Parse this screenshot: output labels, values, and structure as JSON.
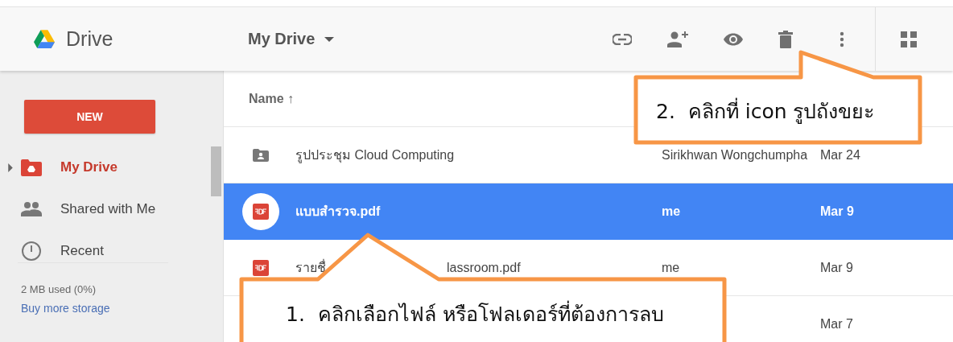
{
  "app": {
    "name": "Drive"
  },
  "location": {
    "title": "My Drive"
  },
  "new_button": "NEW",
  "sidebar": {
    "items": [
      {
        "kind": "drive",
        "label": "My Drive",
        "selected": true
      },
      {
        "kind": "shared",
        "label": "Shared with Me",
        "selected": false
      },
      {
        "kind": "recent",
        "label": "Recent",
        "selected": false
      }
    ],
    "usage": "2 MB used (0%)",
    "link": "Buy more storage"
  },
  "table": {
    "columns": [
      {
        "label": "Name ↑"
      }
    ],
    "rows": [
      {
        "kind": "folder",
        "name_parts": [
          "รูปประชุม Cloud Computing"
        ],
        "owner": "Sirikhwan Wongchumpha",
        "modified": "Mar 24",
        "selected": false
      },
      {
        "kind": "pdf",
        "name_parts": [
          "แบบสำรวจ.pdf"
        ],
        "owner": "me",
        "modified": "Mar 9",
        "selected": true
      },
      {
        "kind": "pdf",
        "name_parts": [
          "รายชื่",
          "lassroom.pdf"
        ],
        "owner": "me",
        "modified": "Mar 9",
        "selected": false
      },
      {
        "modified": "Mar 7",
        "selected": false
      }
    ]
  },
  "callouts": [
    {
      "text": "2.  คลิกที่ icon รูปถังขยะ"
    },
    {
      "text": "1.  คลิกเลือกไฟล์ หรือโฟลเดอร์ที่ต้องการลบ"
    }
  ]
}
